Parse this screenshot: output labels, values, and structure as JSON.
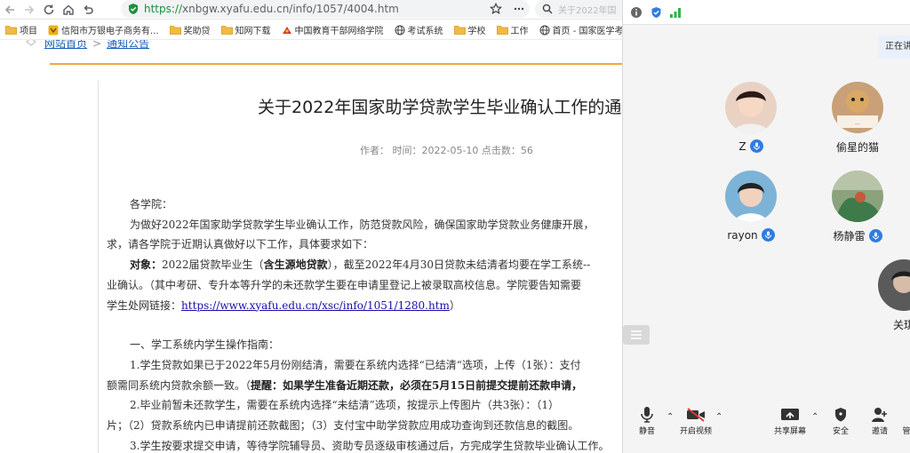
{
  "browser": {
    "url_scheme": "https://",
    "url_rest": "xnbgw.xyafu.edu.cn/info/1057/4004.htm",
    "search_ghost": "关于2022年国",
    "bookmarks": [
      {
        "label": "项目",
        "icon": "folder-icon"
      },
      {
        "label": "信阳市万银电子商务有...",
        "icon": "site-icon"
      },
      {
        "label": "奖助贷",
        "icon": "folder-icon"
      },
      {
        "label": "知网下载",
        "icon": "folder-icon"
      },
      {
        "label": "中国教育干部网络学院",
        "icon": "site-icon"
      },
      {
        "label": "考试系统",
        "icon": "globe-icon"
      },
      {
        "label": "学校",
        "icon": "folder-icon"
      },
      {
        "label": "工作",
        "icon": "folder-icon"
      },
      {
        "label": "首页 - 国家医学考试...",
        "icon": "globe-icon"
      }
    ]
  },
  "page": {
    "breadcrumb": {
      "home": "网站首页",
      "section": "通知公告"
    },
    "title": "关于2022年国家助学贷款学生毕业确认工作的通",
    "meta": "作者：  时间：2022-05-10 点击数：56",
    "paragraphs": {
      "p1": "各学院：",
      "p2a": "为做好2022年国家助学贷款学生毕业确认工作，防范贷款风险，确保国家助学贷款业务健康开展，",
      "p2b": "求，请各学院于近期认真做好以下工作，具体要求如下：",
      "p3_label": "对象：",
      "p3a_pre": "2022届贷款毕业生（",
      "p3a_bold": "含生源地贷款",
      "p3a_post": "），截至2022年4月30日贷款未结清者均要在学工系统--",
      "p3b": "业确认。（其中考研、专升本等升学的未还款学生要在申请里登记上被录取高校信息。学院要告知需要",
      "p3c_pre": "学生处网链接：",
      "p3c_link": "https://www.xyafu.edu.cn/xsc/info/1051/1280.htm",
      "p3c_post": "）",
      "h1": "一、学工系统内学生操作指南：",
      "s1a": "1.学生贷款如果已于2022年5月份刚结清，需要在系统内选择“已结清“选项，上传（1张）：支付",
      "s1b_pre": "额需同系统内贷款余额一致。（",
      "s1b_bold": "提醒：如果学生准备近期还款，必须在5月15日前提交提前还款申请，",
      "s2a": "2.毕业前暂未还款学生，需要在系统内选择“未结清”选项，按提示上传图片（共3张）：（1）",
      "s2b": "片；（2）贷款系统内已申请提前还款截图；（3）支付宝中助学贷款应用成功查询到还款信息的截图。",
      "s3": "3.学生按要求提交申请，等待学院辅导员、资助专员逐级审核通过后，方完成学生贷款毕业确认工作。"
    }
  },
  "meeting": {
    "speaking_label": "正在讲",
    "participants": [
      {
        "name": "Z",
        "mic": true,
        "avatar_color": "#e9d2c4"
      },
      {
        "name": "偷星的猫",
        "mic": false,
        "avatar_color": "#c9a077"
      },
      {
        "name": "rayon",
        "mic": true,
        "avatar_color": "#7eb3d8"
      },
      {
        "name": "杨静雷",
        "mic": true,
        "avatar_color": "#8aa37d"
      },
      {
        "name": "关琪",
        "mic": false,
        "avatar_color": "#5a5a5a"
      }
    ],
    "toolbar": {
      "mute": "静音",
      "video": "开启视频",
      "share": "共享屏幕",
      "security": "安全",
      "invite": "邀请",
      "manage": "管"
    },
    "colors": {
      "accent": "#2f7de1",
      "bar_bg": "#f4f4f4"
    }
  }
}
